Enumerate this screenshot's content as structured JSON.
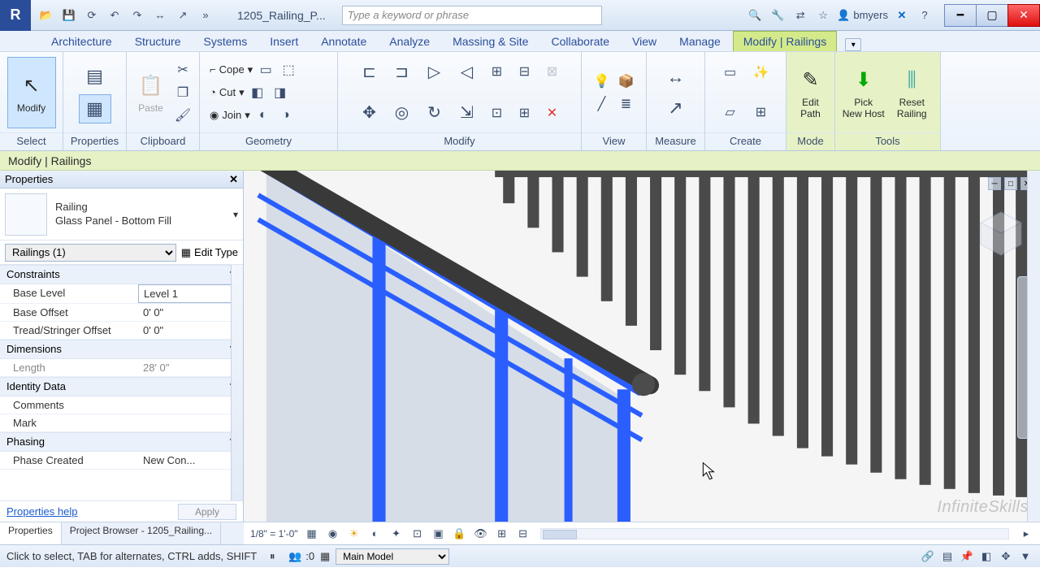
{
  "titlebar": {
    "filename": "1205_Railing_P...",
    "search_placeholder": "Type a keyword or phrase",
    "username": "bmyers"
  },
  "ribbon_tabs": [
    "Architecture",
    "Structure",
    "Systems",
    "Insert",
    "Annotate",
    "Analyze",
    "Massing & Site",
    "Collaborate",
    "View",
    "Manage",
    "Modify | Railings"
  ],
  "ribbon_active_tab": "Modify | Railings",
  "ribbon": {
    "select": {
      "title": "Select",
      "modify": "Modify"
    },
    "properties": {
      "title": "Properties"
    },
    "clipboard": {
      "title": "Clipboard",
      "paste": "Paste"
    },
    "geometry": {
      "title": "Geometry",
      "cope": "Cope",
      "cut": "Cut",
      "join": "Join"
    },
    "modify": {
      "title": "Modify"
    },
    "view": {
      "title": "View"
    },
    "measure": {
      "title": "Measure"
    },
    "create": {
      "title": "Create"
    },
    "mode": {
      "title": "Mode",
      "edit_path": "Edit\nPath"
    },
    "tools": {
      "title": "Tools",
      "pick_host": "Pick\nNew Host",
      "reset_railing": "Reset\nRailing"
    }
  },
  "context_bar": "Modify | Railings",
  "properties": {
    "panel_title": "Properties",
    "family_category": "Railing",
    "family_type": "Glass Panel - Bottom Fill",
    "instance_filter": "Railings (1)",
    "edit_type": "Edit Type",
    "groups": {
      "constraints": {
        "label": "Constraints",
        "rows": [
          {
            "label": "Base Level",
            "value": "Level 1",
            "editable": true
          },
          {
            "label": "Base Offset",
            "value": "0'  0\""
          },
          {
            "label": "Tread/Stringer Offset",
            "value": "0'  0\""
          }
        ]
      },
      "dimensions": {
        "label": "Dimensions",
        "rows": [
          {
            "label": "Length",
            "value": "28'  0\"",
            "dim": true
          }
        ]
      },
      "identity": {
        "label": "Identity Data",
        "rows": [
          {
            "label": "Comments",
            "value": ""
          },
          {
            "label": "Mark",
            "value": ""
          }
        ]
      },
      "phasing": {
        "label": "Phasing",
        "rows": [
          {
            "label": "Phase Created",
            "value": "New Con..."
          }
        ]
      }
    },
    "help_link": "Properties help",
    "apply": "Apply",
    "tabs": {
      "properties": "Properties",
      "project_browser": "Project Browser - 1205_Railing..."
    }
  },
  "view_bar": {
    "scale": "1/8\" = 1'-0\""
  },
  "statusbar": {
    "hint": "Click to select, TAB for alternates, CTRL adds, SHIFT",
    "count": ":0",
    "workset": "Main Model"
  },
  "watermark": "InfiniteSkills"
}
